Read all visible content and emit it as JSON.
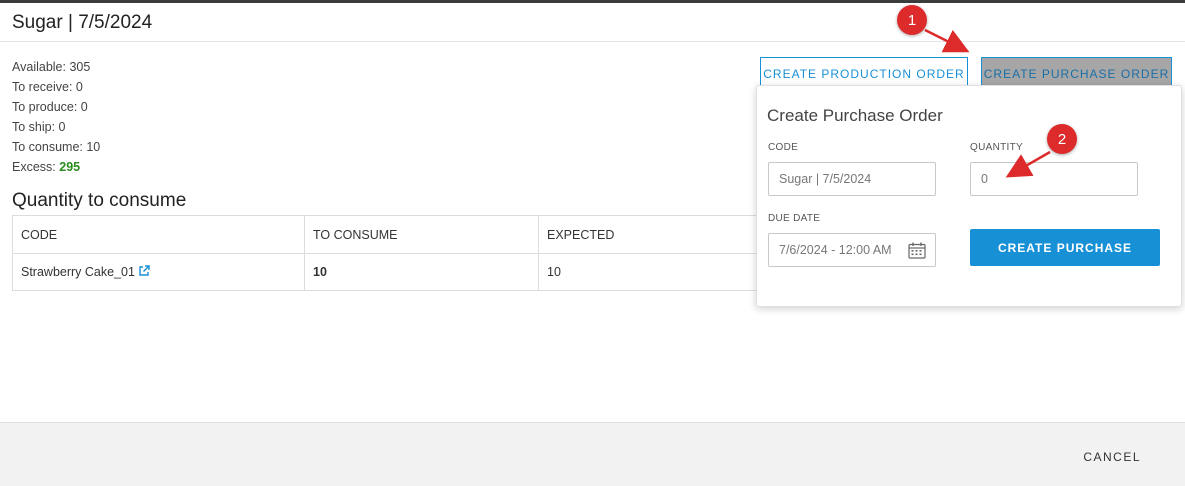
{
  "header": {
    "title": "Sugar | 7/5/2024"
  },
  "stats": {
    "available": "Available: 305",
    "to_receive": "To receive: 0",
    "to_produce": "To produce: 0",
    "to_ship": "To ship: 0",
    "to_consume": "To consume: 10",
    "excess_label": "Excess:",
    "excess_value": "295"
  },
  "section": {
    "title": "Quantity to consume"
  },
  "table": {
    "headers": [
      "CODE",
      "TO CONSUME",
      "EXPECTED"
    ],
    "rows": [
      {
        "code": "Strawberry Cake_01",
        "to_consume": "10",
        "expected": "10"
      }
    ]
  },
  "actions": {
    "create_production_order": "CREATE PRODUCTION ORDER",
    "create_purchase_order": "CREATE PURCHASE ORDER"
  },
  "popup": {
    "title": "Create Purchase Order",
    "code_label": "CODE",
    "code_value": "Sugar | 7/5/2024",
    "quantity_label": "QUANTITY",
    "quantity_value": "0",
    "due_date_label": "DUE DATE",
    "due_date_value": "7/6/2024 - 12:00 AM",
    "create_button": "CREATE PURCHASE"
  },
  "footer": {
    "cancel": "CANCEL"
  },
  "annotations": {
    "badge1": "1",
    "badge2": "2"
  },
  "colors": {
    "accent": "#1890d6",
    "excess": "#2a8c1e",
    "badge": "#dd2a2a"
  },
  "icons": {
    "external_link": "external-link-icon",
    "calendar": "calendar-icon"
  }
}
